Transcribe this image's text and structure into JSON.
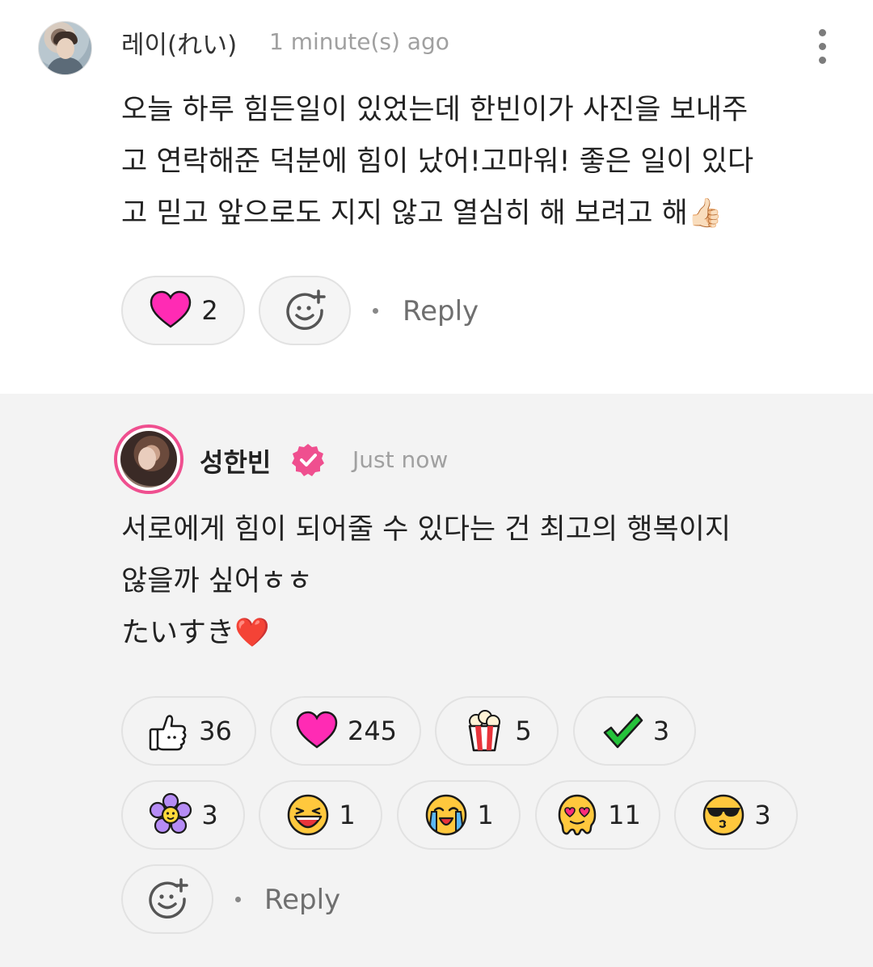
{
  "comment": {
    "author": "레이(れい)",
    "time": "1 minute(s) ago",
    "text": "오늘 하루 힘든일이 있었는데 한빈이가 사진을 보내주\n고 연락해준 덕분에 힘이 났어!고마워! 좋은 일이 있다\n고 믿고 앞으로도 지지 않고 열심히 해 보려고 해👍🏻",
    "reactions": [
      {
        "icon": "heart-icon",
        "count": "2"
      }
    ],
    "reply_label": "Reply"
  },
  "reply": {
    "author": "성한빈",
    "verified": true,
    "time": "Just now",
    "text": "서로에게 힘이 되어줄 수 있다는 건 최고의 행복이지\n않을까 싶어ㅎㅎ\nたいすき❤️",
    "reactions": [
      {
        "icon": "thumbs-up-icon",
        "count": "36"
      },
      {
        "icon": "heart-icon",
        "count": "245"
      },
      {
        "icon": "popcorn-icon",
        "count": "5"
      },
      {
        "icon": "checkmark-icon",
        "count": "3"
      },
      {
        "icon": "flower-icon",
        "count": "3"
      },
      {
        "icon": "laughing-face-icon",
        "count": "1"
      },
      {
        "icon": "crying-face-icon",
        "count": "1"
      },
      {
        "icon": "melting-face-icon",
        "count": "11"
      },
      {
        "icon": "cool-face-icon",
        "count": "3"
      }
    ],
    "reply_label": "Reply"
  },
  "colors": {
    "accent_pink": "#ef4f8f",
    "heart": "#ff2bb4",
    "reply_bg": "#f3f3f3"
  }
}
